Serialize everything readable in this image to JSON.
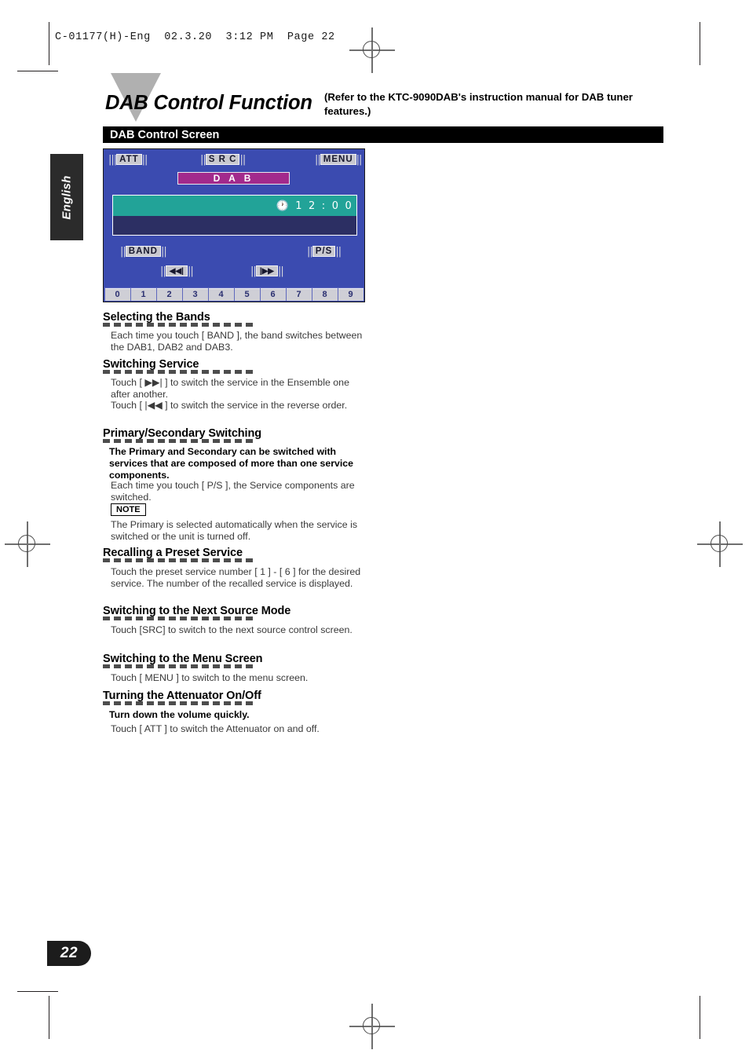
{
  "film_header": "C-01177(H)-Eng  02.3.20  3:12 PM  Page 22",
  "language_tab": "English",
  "page_number": "22",
  "title": {
    "heading": "DAB Control Function",
    "note": "(Refer to the KTC-9090DAB's instruction manual for DAB tuner features.)",
    "section_bar": "DAB Control Screen"
  },
  "lcd": {
    "att_label": "ATT",
    "src_label": "S R C",
    "menu_label": "MENU",
    "source_tag": "D A B",
    "clock": "🕐 1 2 : 0 0",
    "band_label": "BAND",
    "ps_label": "P/S",
    "prev_label": "◀◀|",
    "next_label": "|▶▶",
    "presets": [
      "0",
      "1",
      "2",
      "3",
      "4",
      "5",
      "6",
      "7",
      "8",
      "9"
    ],
    "colors": {
      "screen_bg": "#3b4bb0",
      "tag_magenta": "#a22a8c",
      "band_teal": "#22a398",
      "band_navy": "#2c2f63",
      "preset_bar": "#5e68bd"
    }
  },
  "sections": [
    {
      "heading": "Selecting the Bands",
      "body": [
        {
          "style": "normal",
          "text": "Each time you touch [ BAND ], the band switches between the DAB1, DAB2 and DAB3."
        }
      ]
    },
    {
      "heading": "Switching Service",
      "body": [
        {
          "style": "normal",
          "text": "Touch [ ▶▶| ] to switch the service in the Ensemble one after another."
        },
        {
          "style": "normal",
          "text": "Touch [ |◀◀ ] to switch the service in the reverse order."
        }
      ]
    },
    {
      "heading": "Primary/Secondary Switching",
      "body": [
        {
          "style": "bold",
          "text": "The Primary and Secondary can be switched with services that are composed of more than one service components."
        },
        {
          "style": "normal",
          "text": "Each time you touch [ P/S ], the Service components are switched."
        },
        {
          "style": "note-label",
          "text": "NOTE"
        },
        {
          "style": "normal",
          "text": "The Primary is selected automatically when the service is switched or the unit is turned off."
        }
      ]
    },
    {
      "heading": "Recalling a Preset Service",
      "body": [
        {
          "style": "normal",
          "text": "Touch the preset service number [ 1 ] - [ 6 ] for the desired service. The number of the recalled service is displayed."
        }
      ]
    },
    {
      "heading": "Switching to the Next Source Mode",
      "body": [
        {
          "style": "normal",
          "text": "Touch [SRC] to switch to the next source control screen."
        }
      ]
    },
    {
      "heading": "Switching to the Menu Screen",
      "body": [
        {
          "style": "normal",
          "text": "Touch [ MENU ] to switch to the menu screen."
        }
      ]
    },
    {
      "heading": "Turning the Attenuator On/Off",
      "body": [
        {
          "style": "bold",
          "text": "Turn down the volume quickly."
        },
        {
          "style": "normal",
          "text": "Touch [ ATT ] to switch the Attenuator on and off."
        }
      ]
    }
  ]
}
